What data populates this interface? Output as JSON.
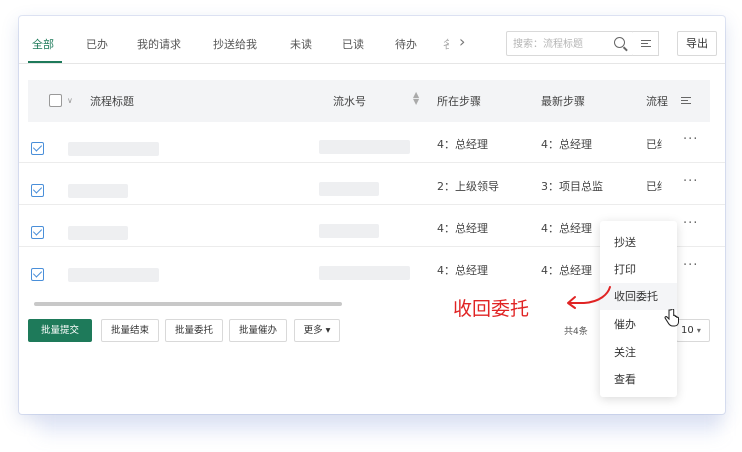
{
  "tabs": {
    "items": [
      {
        "label": "全部",
        "active": true
      },
      {
        "label": "已办"
      },
      {
        "label": "我的请求"
      },
      {
        "label": "抄送给我"
      },
      {
        "label": "未读"
      },
      {
        "label": "已读"
      },
      {
        "label": "待办"
      }
    ],
    "cut_label": "名"
  },
  "search": {
    "placeholder": "搜索：流程标题"
  },
  "toolbar": {
    "export_label": "导出"
  },
  "table": {
    "columns": [
      "流程标题",
      "流水号",
      "所在步骤",
      "最新步骤",
      "流程"
    ],
    "rows": [
      {
        "current_step": "4：总经理",
        "latest_step": "4：总经理",
        "status": "已结"
      },
      {
        "current_step": "2：上级领导",
        "latest_step": "3：项目总监",
        "status": "已结"
      },
      {
        "current_step": "4：总经理",
        "latest_step": "4：总经理",
        "status": ""
      },
      {
        "current_step": "4：总经理",
        "latest_step": "4：总经理",
        "status": ""
      }
    ],
    "more_glyph": "···"
  },
  "footer": {
    "batch_submit": "批量提交",
    "batch_end": "批量结束",
    "batch_delegate": "批量委托",
    "batch_urge": "批量催办",
    "more": "更多",
    "total": "共4条",
    "page_size": "10"
  },
  "menu": {
    "items": [
      "抄送",
      "打印",
      "收回委托",
      "催办",
      "关注",
      "查看"
    ],
    "hovered": "收回委托"
  },
  "annotation": {
    "text": "收回委托",
    "color": "#e02424"
  },
  "colors": {
    "accent": "#1e7a5a",
    "checkbox": "#4a8fd9"
  }
}
